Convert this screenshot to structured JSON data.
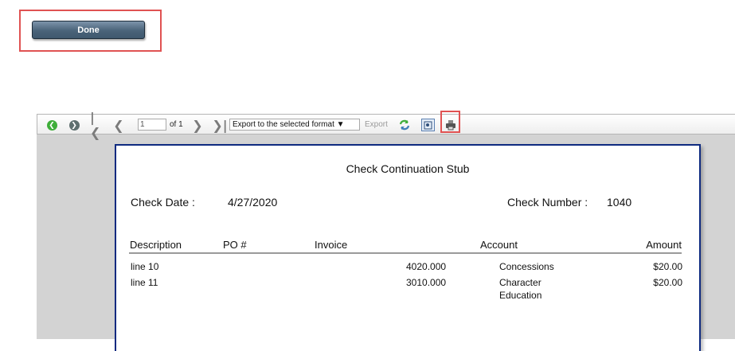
{
  "done_button": {
    "label": "Done"
  },
  "toolbar": {
    "page_number": "1",
    "page_of": "of 1",
    "export_format": "Export to the selected format",
    "export_label": "Export",
    "icons": [
      "back-icon",
      "forward-icon",
      "first-page-icon",
      "previous-page-icon",
      "next-page-icon",
      "last-page-icon",
      "refresh-icon",
      "properties-icon",
      "print-icon"
    ]
  },
  "report": {
    "title": "Check Continuation Stub",
    "check_date_label": "Check Date :",
    "check_date": "4/27/2020",
    "check_number_label": "Check Number :",
    "check_number": "1040",
    "columns": [
      "Description",
      "PO #",
      "Invoice",
      "Account",
      "Amount"
    ],
    "rows": [
      {
        "description": "line 10",
        "po": "",
        "invoice": "",
        "account_number": "4020.000",
        "account_name": "Concessions",
        "amount": "$20.00"
      },
      {
        "description": "line 11",
        "po": "",
        "invoice": "",
        "account_number": "3010.000",
        "account_name_line1": "Character",
        "account_name_line2": "Education",
        "amount": "$20.00"
      }
    ]
  },
  "colors": {
    "highlight": "#e05252",
    "page_border": "#0e2a80",
    "button": "#4a6379"
  }
}
